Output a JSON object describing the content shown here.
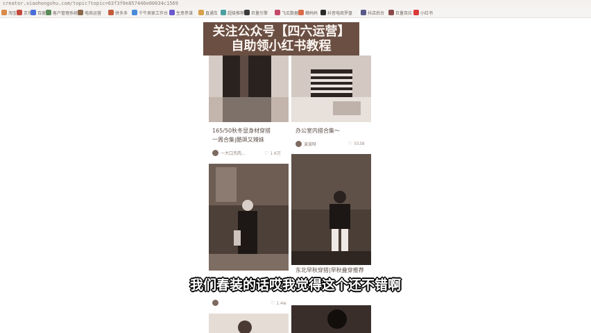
{
  "browser": {
    "url": "creator.xiaohongshu.com/topic?topic=63f3f0e857446e00034c1569",
    "bookmarks": [
      {
        "label": "淘宝",
        "color": "#d98a4a"
      },
      {
        "label": "京东",
        "color": "#c44a3a"
      },
      {
        "label": "百度",
        "color": "#4a6fd9"
      },
      {
        "label": "客户管理系统",
        "color": "#5a8a5a"
      },
      {
        "label": "电商运营",
        "color": "#8a6a4a"
      },
      {
        "label": "拼多多",
        "color": "#c45a3a"
      },
      {
        "label": "千牛卖家工作台",
        "color": "#4a8ad9"
      },
      {
        "label": "生意参谋",
        "color": "#6a5acd"
      },
      {
        "label": "直通车",
        "color": "#d9a04a"
      },
      {
        "label": "超级推荐",
        "color": "#4aa0a0"
      },
      {
        "label": "巨量引擎",
        "color": "#3a3a3a"
      },
      {
        "label": "飞瓜数据",
        "color": "#c44a6a"
      },
      {
        "label": "蝉妈妈",
        "color": "#d96a4a"
      },
      {
        "label": "抖音电商罗盘",
        "color": "#2a2a2a"
      },
      {
        "label": "抖店后台",
        "color": "#5a5a8a"
      },
      {
        "label": "巨量百应",
        "color": "#8a4a4a"
      },
      {
        "label": "小红书",
        "color": "#d93a3a"
      }
    ]
  },
  "banner": {
    "line1": "关注公众号【四六运营】",
    "line2": "自助领小红书教程"
  },
  "cards": [
    {
      "title_line1": "165/50秋冬显身材穿搭",
      "title_line2": "一周合集|酷飒又辣妹",
      "author": "一大口杰肉...",
      "likes": "1.6万",
      "palette": [
        "#2d2421",
        "#6e5a50",
        "#cfc3bc"
      ]
    },
    {
      "title_line1": "办公室内搭合集～",
      "title_line2": "",
      "author": "波波呀",
      "likes": "5538",
      "palette": [
        "#c8bdb6",
        "#3a2f2b",
        "#eae3de"
      ]
    },
    {
      "title_line1": "",
      "title_line2": "",
      "author": "",
      "likes": "",
      "palette": [
        "#5a4a40",
        "#201a17",
        "#8a7a6e"
      ]
    },
    {
      "title_line1": "东北早秋穿搭|早秋叠穿推荐",
      "title_line2": "",
      "author": "",
      "likes": "1.4w",
      "palette": [
        "#4a3e36",
        "#1c1714",
        "#9d8e84"
      ]
    },
    {
      "title_line1": "",
      "title_line2": "",
      "author": "",
      "likes": "",
      "palette": [
        "#e6dcd6",
        "#5a463e",
        "#d2c6bf"
      ]
    },
    {
      "title_line1": "",
      "title_line2": "",
      "author": "",
      "likes": "",
      "palette": [
        "#3a2e2a",
        "#0f0c0b",
        "#6a5a52"
      ]
    }
  ],
  "subtitle": "我们春装的话哎我觉得这个还不错啊"
}
